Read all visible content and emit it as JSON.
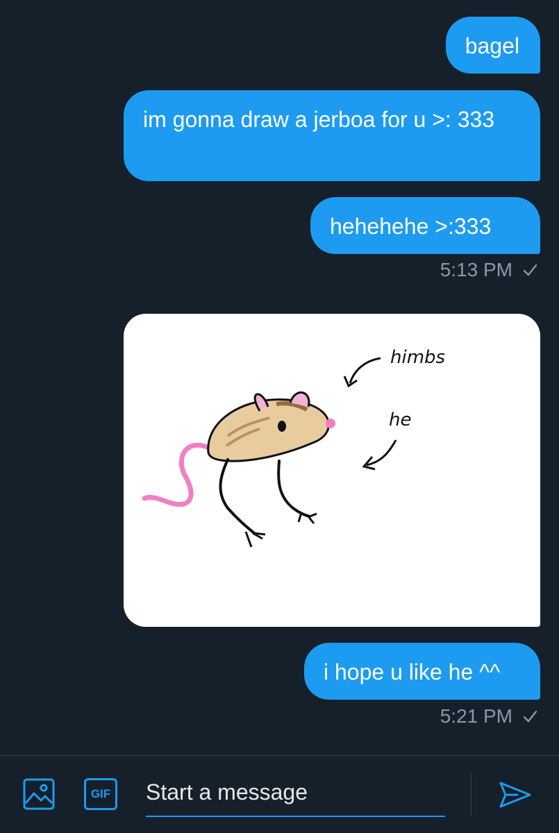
{
  "messages": [
    {
      "text": "bagel"
    },
    {
      "text": "im gonna draw a jerboa for u >: 333"
    },
    {
      "text": "hehehehe >:333"
    },
    {
      "timestamp": "5:13 PM"
    },
    {
      "image_labels": {
        "top": "himbs",
        "middle": "he"
      }
    },
    {
      "text": "i hope u like he ^^"
    },
    {
      "timestamp": "5:21 PM"
    }
  ],
  "composer": {
    "placeholder": "Start a message",
    "gif_label": "GIF"
  },
  "colors": {
    "background": "#15202b",
    "bubble": "#1d9bf0",
    "muted": "#8b98a5",
    "divider": "#38444d"
  },
  "icons": [
    "checkmark-icon",
    "image-icon",
    "gif-icon",
    "send-icon"
  ]
}
